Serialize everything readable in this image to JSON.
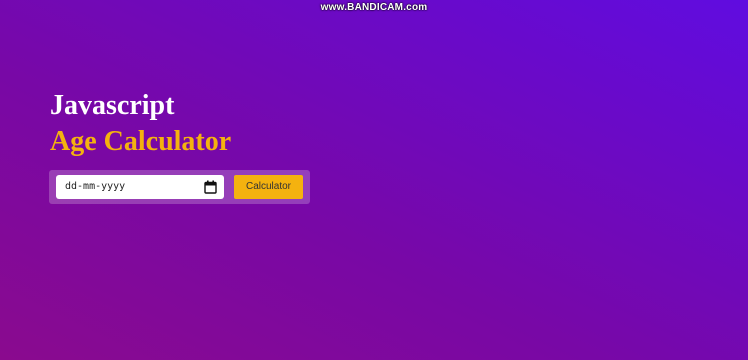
{
  "watermark": "www.BANDICAM.com",
  "header": {
    "title": "Javascript",
    "subtitle": "Age Calculator"
  },
  "form": {
    "date_placeholder": "dd-mm-yyyy",
    "calendar_icon": "calendar-icon",
    "button_label": "Calculator"
  },
  "colors": {
    "accent": "#f4b20f",
    "title": "#ffffff",
    "background_start": "#8a0a8e",
    "background_end": "#600ce0"
  }
}
